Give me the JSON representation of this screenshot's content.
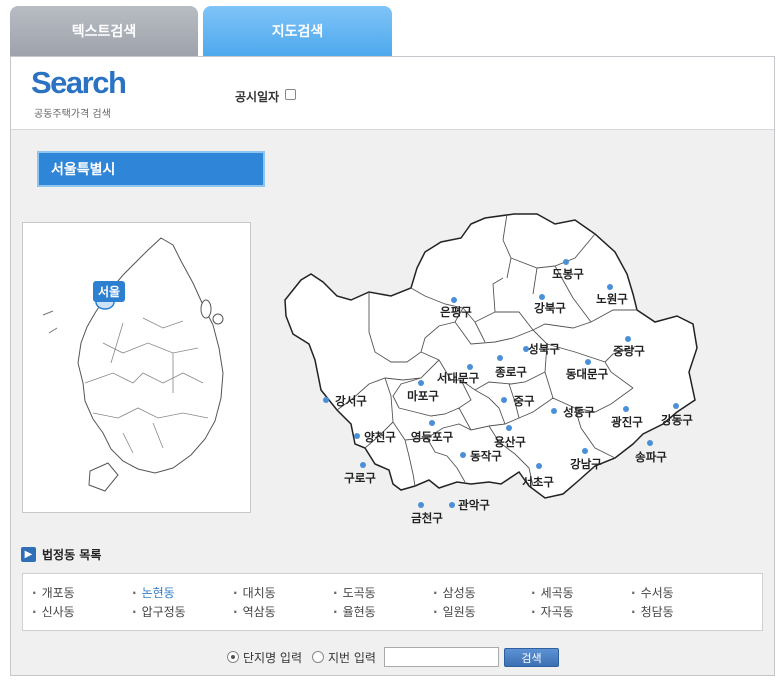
{
  "tabs": [
    {
      "label": "텍스트검색"
    },
    {
      "label": "지도검색"
    }
  ],
  "header": {
    "brand_title": "Search",
    "brand_subtitle": "공동주택가격 검색",
    "notice_label": "공시일자"
  },
  "region": {
    "title": "서울특별시",
    "badge": "서울"
  },
  "districts": [
    {
      "name": "도봉구"
    },
    {
      "name": "노원구"
    },
    {
      "name": "강북구"
    },
    {
      "name": "은평구"
    },
    {
      "name": "성북구"
    },
    {
      "name": "중랑구"
    },
    {
      "name": "종로구"
    },
    {
      "name": "동대문구"
    },
    {
      "name": "서대문구"
    },
    {
      "name": "마포구"
    },
    {
      "name": "강서구"
    },
    {
      "name": "중구"
    },
    {
      "name": "성동구"
    },
    {
      "name": "광진구"
    },
    {
      "name": "강동구"
    },
    {
      "name": "양천구"
    },
    {
      "name": "영등포구"
    },
    {
      "name": "용산구"
    },
    {
      "name": "동작구"
    },
    {
      "name": "강남구"
    },
    {
      "name": "송파구"
    },
    {
      "name": "구로구"
    },
    {
      "name": "서초구"
    },
    {
      "name": "관악구"
    },
    {
      "name": "금천구"
    }
  ],
  "dong_list": {
    "title": "법정동 목록",
    "items": [
      {
        "label": "개포동"
      },
      {
        "label": "논현동"
      },
      {
        "label": "대치동"
      },
      {
        "label": "도곡동"
      },
      {
        "label": "삼성동"
      },
      {
        "label": "세곡동"
      },
      {
        "label": "수서동"
      },
      {
        "label": "신사동"
      },
      {
        "label": "압구정동"
      },
      {
        "label": "역삼동"
      },
      {
        "label": "율현동"
      },
      {
        "label": "일원동"
      },
      {
        "label": "자곡동"
      },
      {
        "label": "청담동"
      }
    ],
    "active_item": "논현동"
  },
  "search": {
    "option_complex": "단지명 입력",
    "option_lot": "지번 입력",
    "input_value": "",
    "button_label": "검색"
  },
  "colors": {
    "accent": "#2f86d8",
    "tab_active": "#4ea8ec",
    "tab_inactive": "#9ea3ab"
  }
}
